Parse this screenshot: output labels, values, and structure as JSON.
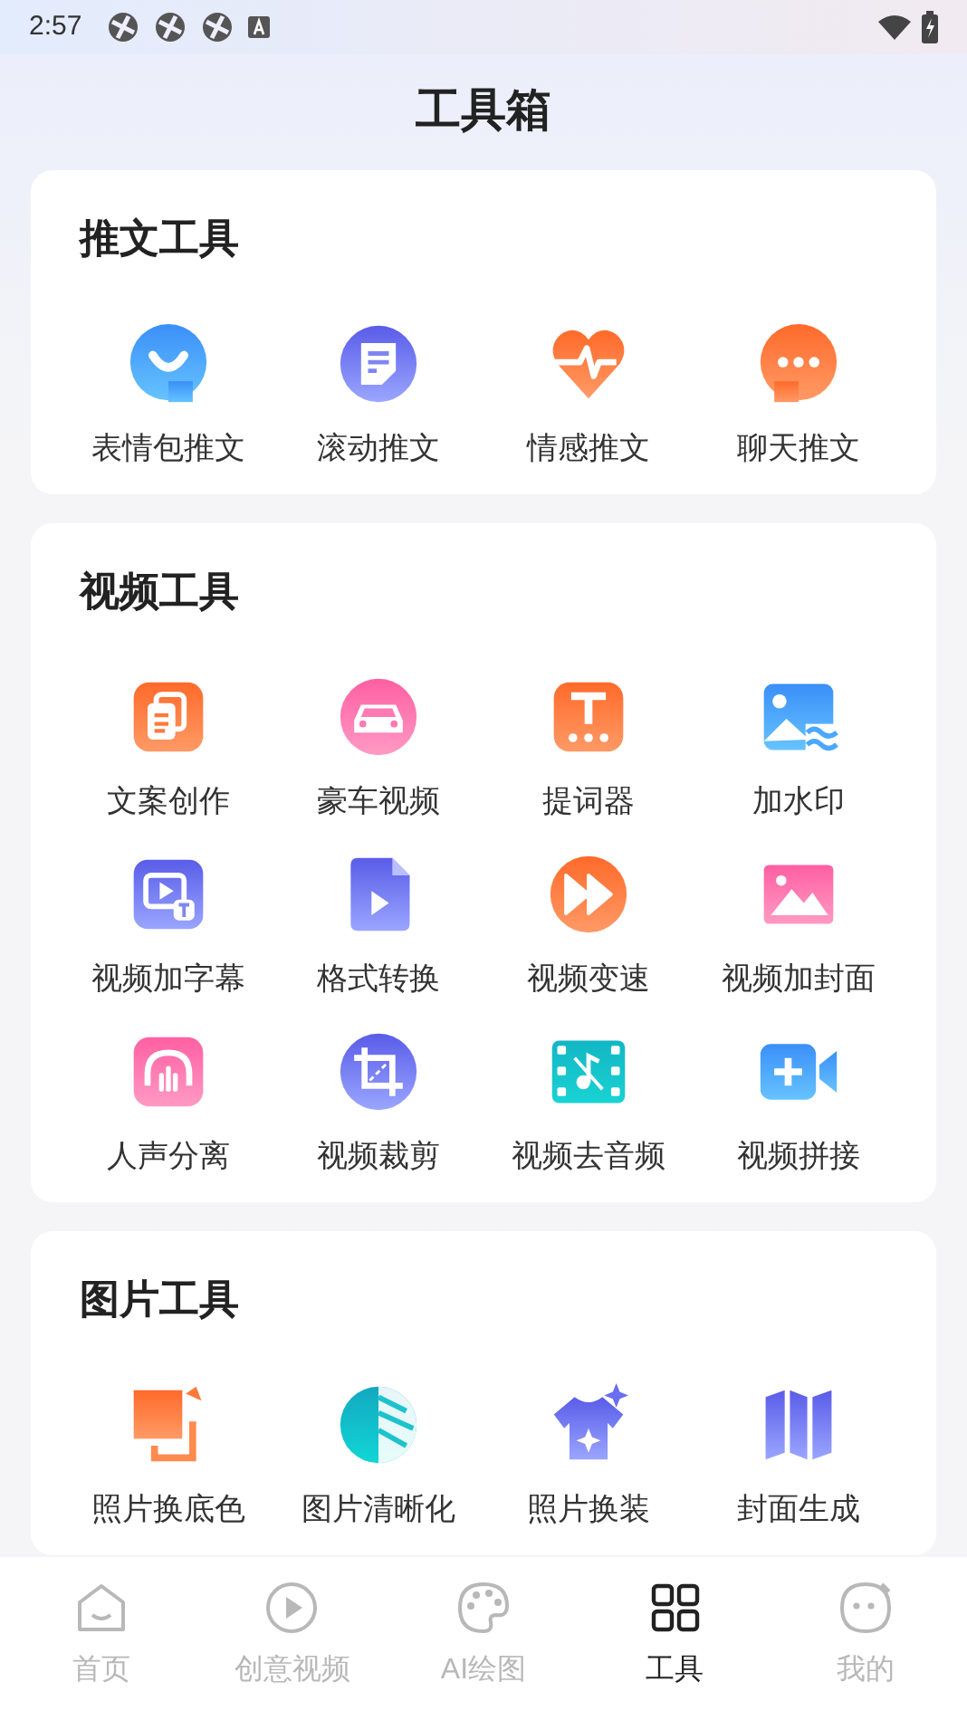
{
  "status_bar": {
    "time": "2:57"
  },
  "title": "工具箱",
  "sections": [
    {
      "title": "推文工具",
      "tools": [
        "表情包推文",
        "滚动推文",
        "情感推文",
        "聊天推文"
      ]
    },
    {
      "title": "视频工具",
      "tools": [
        "文案创作",
        "豪车视频",
        "提词器",
        "加水印",
        "视频加字幕",
        "格式转换",
        "视频变速",
        "视频加封面",
        "人声分离",
        "视频裁剪",
        "视频去音频",
        "视频拼接"
      ]
    },
    {
      "title": "图片工具",
      "tools": [
        "照片换底色",
        "图片清晰化",
        "照片换装",
        "封面生成"
      ]
    }
  ],
  "tab_bar": [
    {
      "label": "首页",
      "selected": false
    },
    {
      "label": "创意视频",
      "selected": false
    },
    {
      "label": "AI绘图",
      "selected": false
    },
    {
      "label": "工具",
      "selected": true
    },
    {
      "label": "我的",
      "selected": false
    }
  ]
}
